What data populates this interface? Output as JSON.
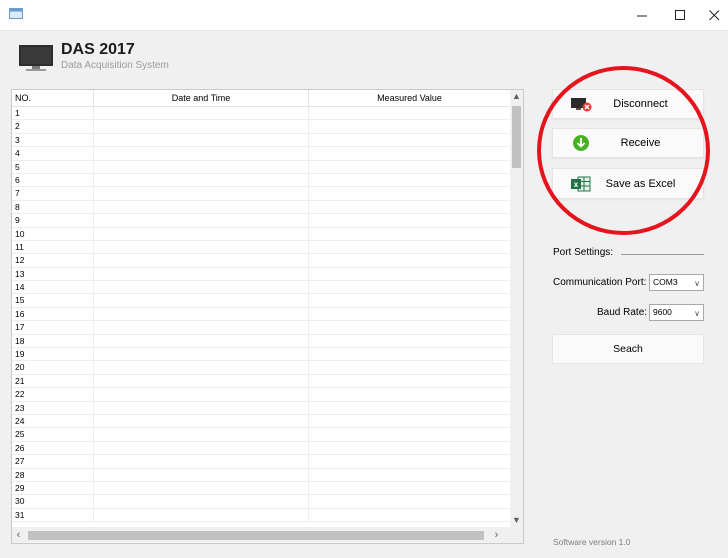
{
  "window": {
    "minimize_glyph": "–",
    "maximize_glyph": "□",
    "close_glyph": "✕"
  },
  "header": {
    "title": "DAS 2017",
    "subtitle": "Data Acquisition System"
  },
  "table": {
    "columns": [
      "NO.",
      "Date and Time",
      "Measured Value"
    ],
    "rows": [
      "1",
      "2",
      "3",
      "4",
      "5",
      "6",
      "7",
      "8",
      "9",
      "10",
      "11",
      "12",
      "13",
      "14",
      "15",
      "16",
      "17",
      "18",
      "19",
      "20",
      "21",
      "22",
      "23",
      "24",
      "25",
      "26",
      "27",
      "28",
      "29",
      "30",
      "31"
    ]
  },
  "actions": {
    "disconnect_label": "Disconnect",
    "receive_label": "Receive",
    "save_excel_label": "Save as Excel",
    "excel_badge": "x"
  },
  "port_settings": {
    "heading": "Port Settings:",
    "comm_port_label": "Communication Port:",
    "comm_port_value": "COM3",
    "baud_rate_label": "Baud Rate:",
    "baud_rate_value": "9600",
    "search_label": "Seach"
  },
  "footer": {
    "version": "Software version 1.0"
  },
  "colors": {
    "highlight_circle": "#e5141d",
    "receive_icon": "#4caf28",
    "excel_icon": "#217346",
    "disconnect_badge": "#e53935"
  },
  "icons": [
    "app-window-icon",
    "monitor-icon",
    "disconnect-icon",
    "download-arrow-icon",
    "excel-icon",
    "chevron-down-icon"
  ]
}
